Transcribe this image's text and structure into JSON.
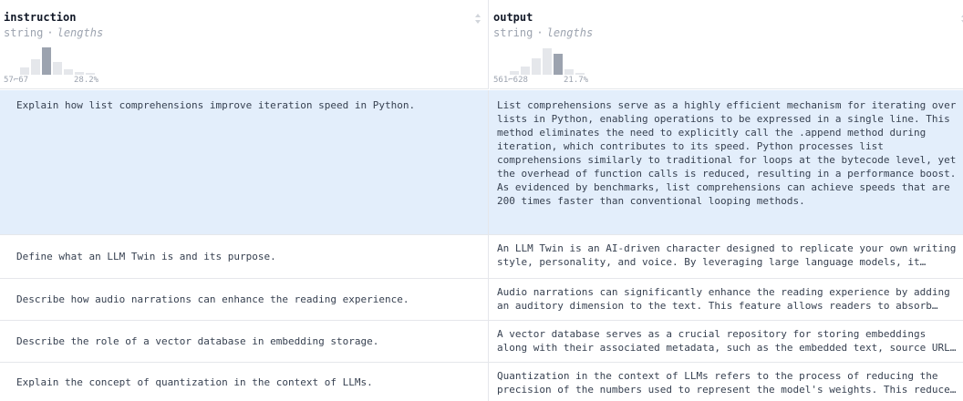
{
  "columns": [
    {
      "name": "instruction",
      "type": "string",
      "subtype": "lengths",
      "histogram": {
        "range": "57⌐67",
        "percent": "28.2%",
        "highlight_index": 2,
        "levels": [
          0.25,
          0.55,
          1.0,
          0.45,
          0.2,
          0.1,
          0.05
        ]
      }
    },
    {
      "name": "output",
      "type": "string",
      "subtype": "lengths",
      "histogram": {
        "range": "561⌐628",
        "percent": "21.7%",
        "highlight_index": 4,
        "levels": [
          0.12,
          0.3,
          0.6,
          0.95,
          0.75,
          0.2,
          0.08
        ]
      }
    }
  ],
  "rows": [
    {
      "instruction": "Explain how list comprehensions improve iteration speed in Python.",
      "output": "List comprehensions serve as a highly efficient mechanism for iterating over lists in Python, enabling operations to be expressed in a single line. This method eliminates the need to explicitly call the .append method during iteration, which contributes to its speed. Python processes list comprehensions similarly to traditional for loops at the bytecode level, yet the overhead of function calls is reduced, resulting in a performance boost. As evidenced by benchmarks, list comprehensions can achieve speeds that are 200 times faster than conventional looping methods.",
      "selected": true
    },
    {
      "instruction": "Define what an LLM Twin is and its purpose.",
      "output": "An LLM Twin is an AI-driven character designed to replicate your own writing style, personality, and voice. By leveraging large language models, it captures the nuances of how you write.",
      "selected": false
    },
    {
      "instruction": "Describe how audio narrations can enhance the reading experience.",
      "output": "Audio narrations can significantly enhance the reading experience by adding an auditory dimension to the text. This feature allows readers to absorb content while multitasking.",
      "selected": false
    },
    {
      "instruction": "Describe the role of a vector database in embedding storage.",
      "output": "A vector database serves as a crucial repository for storing embeddings along with their associated metadata, such as the embedded text, source URLs and creation dates.",
      "selected": false
    },
    {
      "instruction": "Explain the concept of quantization in the context of LLMs.",
      "output": "Quantization in the context of LLMs refers to the process of reducing the precision of the numbers used to represent the model's weights. This reduces memory usage.",
      "selected": false
    }
  ],
  "colors": {
    "selected_row": "#e3eefb",
    "border": "#e5e7eb",
    "hist_bar": "#e5e7eb",
    "hist_highlight": "#9ca3af"
  }
}
